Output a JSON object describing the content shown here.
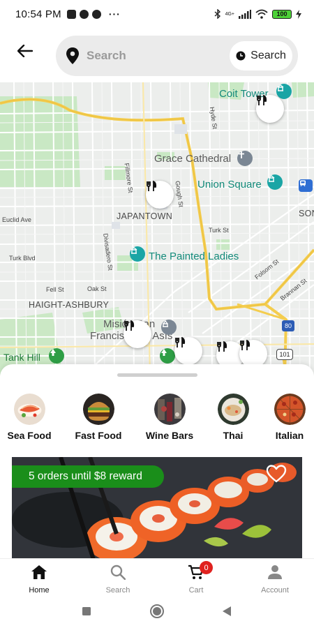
{
  "status_bar": {
    "time": "10:54 PM",
    "more": "···",
    "network_label": "4G+",
    "battery": "100"
  },
  "header": {
    "back_icon": "arrow-left-icon",
    "search_placeholder": "Search",
    "search_button_label": "Search"
  },
  "map": {
    "labels": {
      "coit_tower": "Coit Tower",
      "grace_cathedral": "Grace Cathedral",
      "union_square": "Union Square",
      "japantown": "JAPANTOWN",
      "painted_ladies": "The Painted Ladies",
      "haight_ashbury": "HAIGHT-ASHBURY",
      "mision_dolores_1": "Misión San",
      "mision_dolores_2": "Francisco de Asís",
      "tank_hill": "Tank Hill",
      "soma": "SON",
      "hyde_st": "Hyde St",
      "fillmore_st": "Fillmore St",
      "gough_st": "Gough St",
      "euclid_ave": "Euclid Ave",
      "turk_blvd": "Turk Blvd",
      "turk_st": "Turk St",
      "divisadero_st": "Divisadero St",
      "fell_st": "Fell St",
      "oak_st": "Oak St",
      "folsom_st": "Folsom St",
      "brannan_st": "Brannan St",
      "hwy_80": "80",
      "hwy_101": "101"
    }
  },
  "categories": [
    {
      "label": "Sea Food",
      "icon": "seafood-image"
    },
    {
      "label": "Fast Food",
      "icon": "burger-image"
    },
    {
      "label": "Wine Bars",
      "icon": "wine-bar-image"
    },
    {
      "label": "Thai",
      "icon": "thai-food-image"
    },
    {
      "label": "Italian",
      "icon": "pizza-image"
    }
  ],
  "promo": {
    "banner": "5 orders until $8 reward",
    "image": "sushi-image"
  },
  "bottom_nav": [
    {
      "label": "Home",
      "icon": "home-icon",
      "active": true
    },
    {
      "label": "Search",
      "icon": "search-icon",
      "active": false
    },
    {
      "label": "Cart",
      "icon": "cart-icon",
      "active": false,
      "badge": "0"
    },
    {
      "label": "Account",
      "icon": "account-icon",
      "active": false
    }
  ],
  "colors": {
    "accent_green": "#1a8e1a",
    "badge_red": "#e0221f",
    "map_highway": "#f4cd4e"
  }
}
